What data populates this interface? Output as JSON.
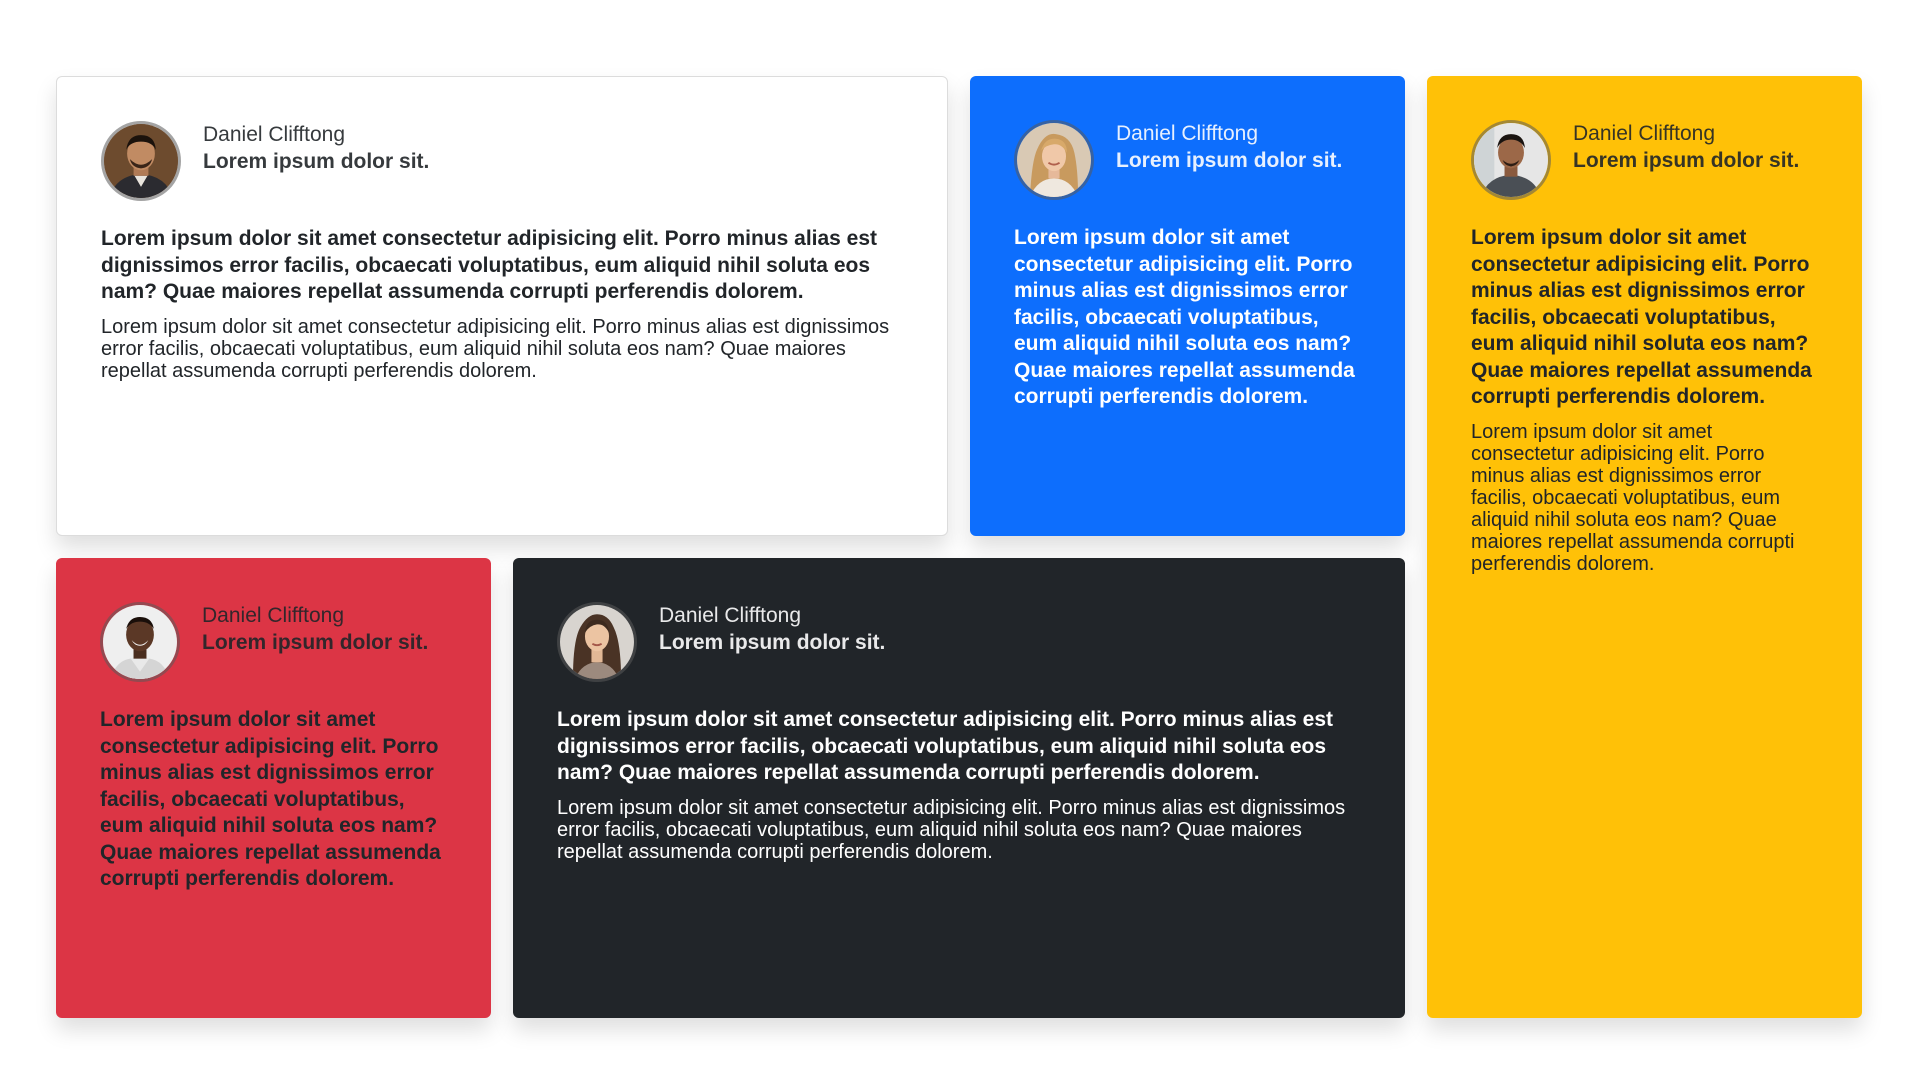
{
  "colors": {
    "white_card": "#ffffff",
    "blue_card": "#0d6efd",
    "yellow_card": "#ffc107",
    "red_card": "#dc3545",
    "dark_card": "#212529"
  },
  "testimonials": [
    {
      "name": "Daniel Clifftong",
      "role": "Lorem ipsum dolor sit.",
      "avatar": "avatar-man-suit",
      "lead": "Lorem ipsum dolor sit amet consectetur adipisicing elit. Porro minus alias est dignissimos error facilis, obcaecati voluptatibus, eum aliquid nihil soluta eos nam? Quae maiores repellat assumenda corrupti perferendis dolorem.",
      "body": "Lorem ipsum dolor sit amet consectetur adipisicing elit. Porro minus alias est dignissimos error facilis, obcaecati voluptatibus, eum aliquid nihil soluta eos nam? Quae maiores repellat assumenda corrupti perferendis dolorem."
    },
    {
      "name": "Daniel Clifftong",
      "role": "Lorem ipsum dolor sit.",
      "avatar": "avatar-woman-blonde",
      "lead": "Lorem ipsum dolor sit amet consectetur adipisicing elit. Porro minus alias est dignissimos error facilis, obcaecati voluptatibus, eum aliquid nihil soluta eos nam? Quae maiores repellat assumenda corrupti perferendis dolorem."
    },
    {
      "name": "Daniel Clifftong",
      "role": "Lorem ipsum dolor sit.",
      "avatar": "avatar-man-casual",
      "lead": "Lorem ipsum dolor sit amet consectetur adipisicing elit. Porro minus alias est dignissimos error facilis, obcaecati voluptatibus, eum aliquid nihil soluta eos nam? Quae maiores repellat assumenda corrupti perferendis dolorem.",
      "body": "Lorem ipsum dolor sit amet consectetur adipisicing elit. Porro minus alias est dignissimos error facilis, obcaecati voluptatibus, eum aliquid nihil soluta eos nam? Quae maiores repellat assumenda corrupti perferendis dolorem."
    },
    {
      "name": "Daniel Clifftong",
      "role": "Lorem ipsum dolor sit.",
      "avatar": "avatar-man-smiling",
      "lead": "Lorem ipsum dolor sit amet consectetur adipisicing elit. Porro minus alias est dignissimos error facilis, obcaecati voluptatibus, eum aliquid nihil soluta eos nam? Quae maiores repellat assumenda corrupti perferendis dolorem."
    },
    {
      "name": "Daniel Clifftong",
      "role": "Lorem ipsum dolor sit.",
      "avatar": "avatar-woman-brunette",
      "lead": "Lorem ipsum dolor sit amet consectetur adipisicing elit. Porro minus alias est dignissimos error facilis, obcaecati voluptatibus, eum aliquid nihil soluta eos nam? Quae maiores repellat assumenda corrupti perferendis dolorem.",
      "body": "Lorem ipsum dolor sit amet consectetur adipisicing elit. Porro minus alias est dignissimos error facilis, obcaecati voluptatibus, eum aliquid nihil soluta eos nam? Quae maiores repellat assumenda corrupti perferendis dolorem."
    }
  ]
}
